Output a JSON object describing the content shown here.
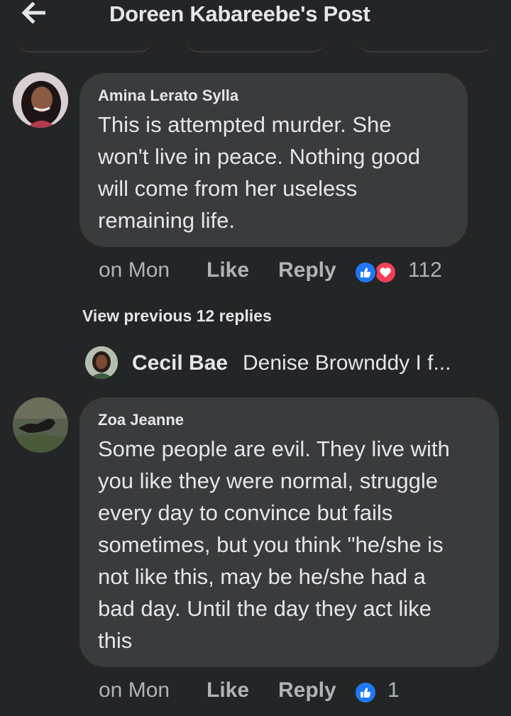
{
  "header": {
    "title": "Doreen Kabareebe's Post",
    "back_icon": "arrow-left-icon"
  },
  "comments": [
    {
      "author": "Amina Lerato Sylla",
      "lines": [
        "This is attempted murder. She",
        "won't live in peace. Nothing good",
        "will come from her useless",
        "remaining life."
      ],
      "time": "on Mon",
      "like_label": "Like",
      "reply_label": "Reply",
      "reactions": [
        "like",
        "love"
      ],
      "reaction_count": "112"
    },
    {
      "author": "Zoa Jeanne",
      "lines": [
        "Some people are evil. They live with",
        "you like they were normal, struggle",
        "every day to convince but fails",
        "sometimes, but you think \"he/she is",
        "not like this, may be he/she had a",
        "bad day. Until the day they act like",
        "this"
      ],
      "time": "on Mon",
      "like_label": "Like",
      "reply_label": "Reply",
      "reactions": [
        "like"
      ],
      "reaction_count": "1"
    }
  ],
  "replies": {
    "view_previous": "View previous 12 replies",
    "latest": {
      "name": "Cecil Bae",
      "snippet": "Denise Brownddy I f..."
    }
  },
  "colors": {
    "background": "#242526",
    "bubble": "#3a3b3c",
    "text_primary": "#e4e6eb",
    "text_secondary": "#b0b3b8",
    "like_blue": "#2078f4",
    "love_red": "#f33e58"
  }
}
